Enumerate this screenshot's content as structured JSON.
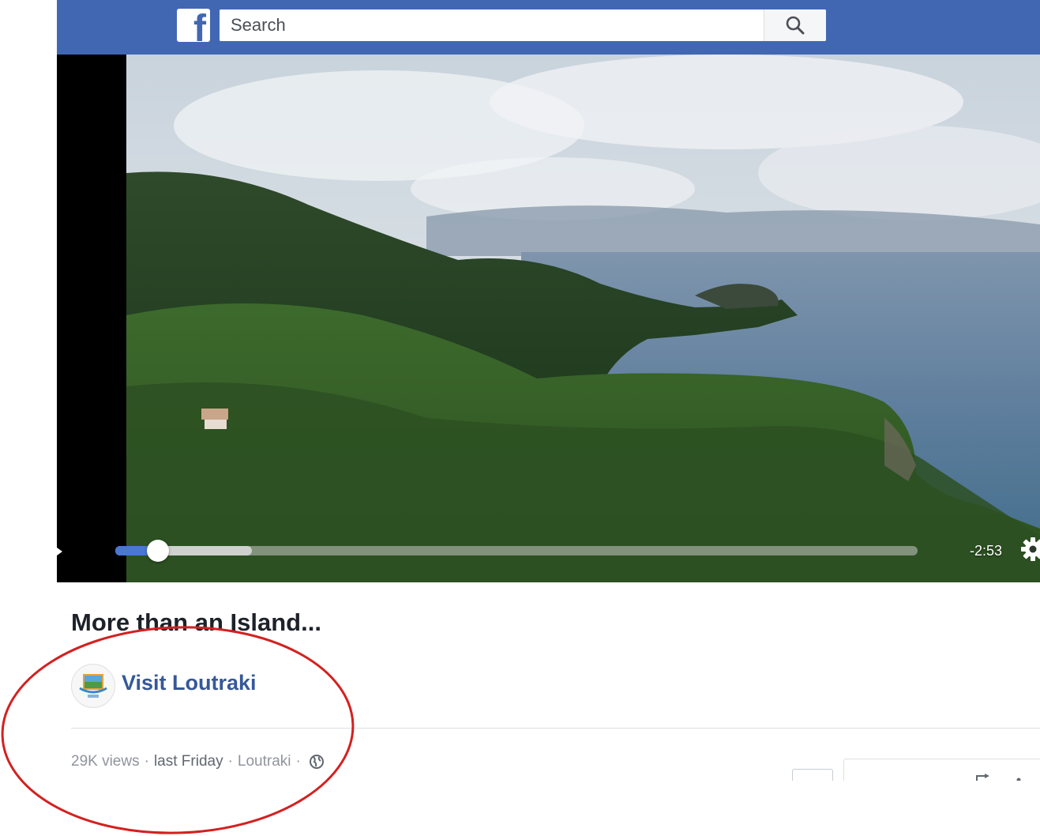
{
  "topbar": {
    "logo_icon": "facebook-f-icon",
    "brand_color": "#4267b2",
    "search": {
      "placeholder": "Search",
      "value": "",
      "icon": "search-icon"
    }
  },
  "video": {
    "progress_fraction": 0.053,
    "buffered_fraction": 0.17,
    "time_remaining": "-2:53",
    "settings_icon": "gear-icon",
    "play_icon": "play-icon"
  },
  "post": {
    "title": "More than an Island...",
    "page_name": "Visit Loutraki",
    "page_name_color": "#365899",
    "avatar_icon": "visit-loutraki-logo",
    "meta": {
      "views": "29K views",
      "separator": "·",
      "date": "last Friday",
      "location": "Loutraki",
      "privacy_icon": "globe-icon"
    }
  },
  "annotation": {
    "shape": "red-circle",
    "color": "#d42020"
  }
}
